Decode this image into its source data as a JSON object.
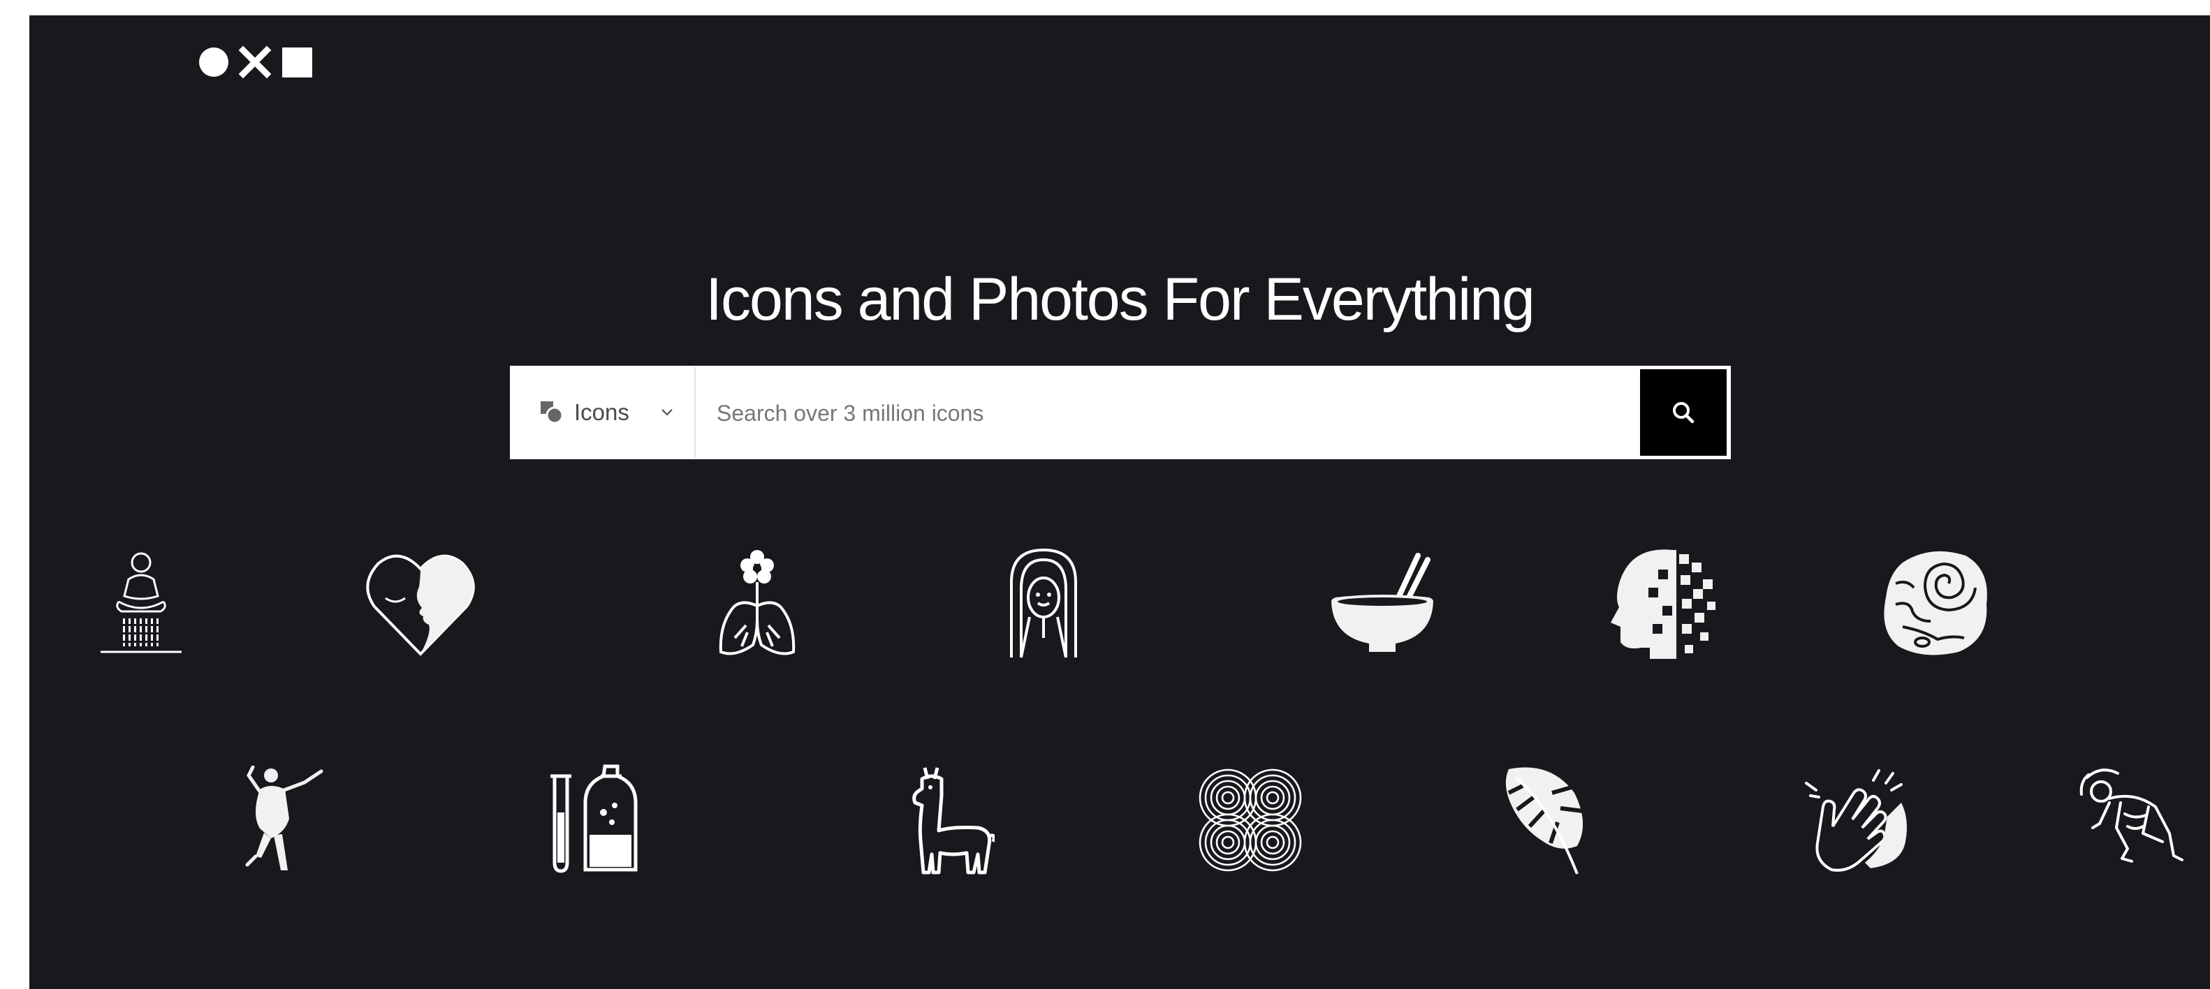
{
  "page": {
    "headline": "Icons and Photos For Everything"
  },
  "search": {
    "type_label": "Icons",
    "placeholder": "Search over 3 million icons",
    "value": ""
  },
  "colors": {
    "background": "#18191d",
    "foreground": "#ffffff",
    "button": "#000000"
  },
  "icons": {
    "logo": "circle-x-square-logo",
    "type": "shapes-icon",
    "dropdown": "chevron-down-icon",
    "search": "search-icon",
    "gallery_row_1": [
      "meditation-icon",
      "heart-face-icon",
      "flower-lungs-icon",
      "woman-portrait-icon",
      "bowl-chopsticks-icon",
      "pixelated-head-icon",
      "fossil-stone-icon"
    ],
    "gallery_row_2": [
      "dancer-icon",
      "test-tube-bottle-icon",
      "llama-icon",
      "spiral-knot-icon",
      "monstera-leaf-icon",
      "clapping-hands-icon",
      "crawling-figure-icon"
    ]
  }
}
